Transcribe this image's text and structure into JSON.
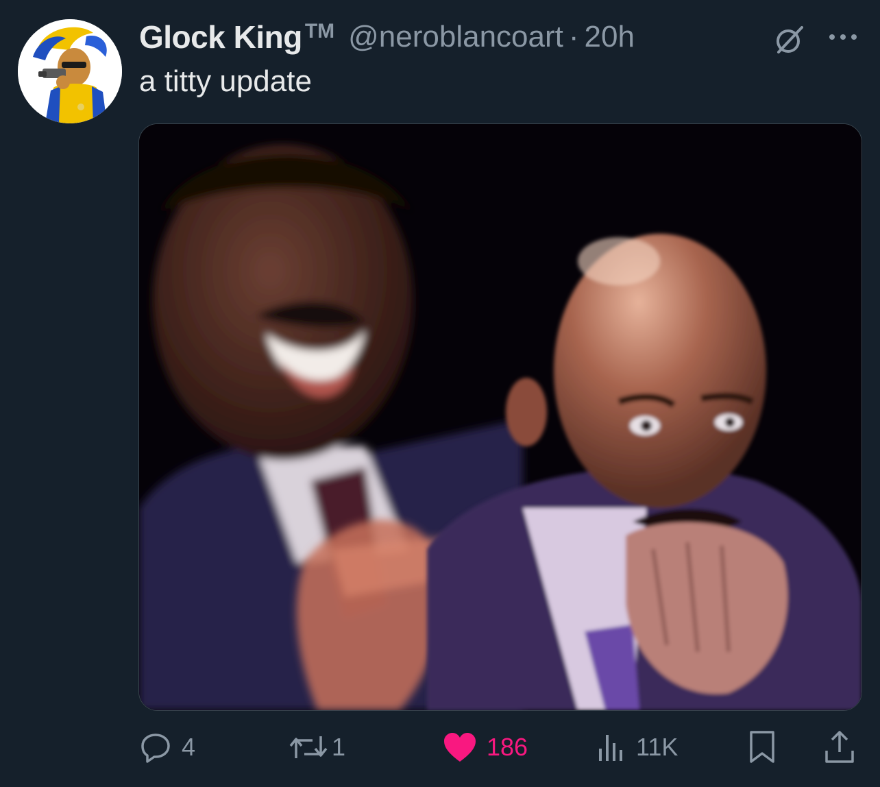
{
  "tweet": {
    "author": {
      "display_name": "Glock King",
      "badge": "TM",
      "handle": "@neroblancoart"
    },
    "separator": "·",
    "time": "20h",
    "text": "a titty update"
  },
  "actions": {
    "replies": "4",
    "reposts": "1",
    "likes": "186",
    "views": "11K"
  },
  "icons": {
    "avatar": "cartoon-character-with-gun-avatar",
    "grok": "grok-icon",
    "more": "more-icon",
    "reply": "reply-icon",
    "repost": "repost-icon",
    "like": "heart-icon",
    "views": "views-icon",
    "bookmark": "bookmark-icon",
    "share": "share-icon"
  },
  "colors": {
    "background": "#15202b",
    "text": "#e7e9ea",
    "muted": "#8b98a5",
    "like": "#f91880"
  }
}
